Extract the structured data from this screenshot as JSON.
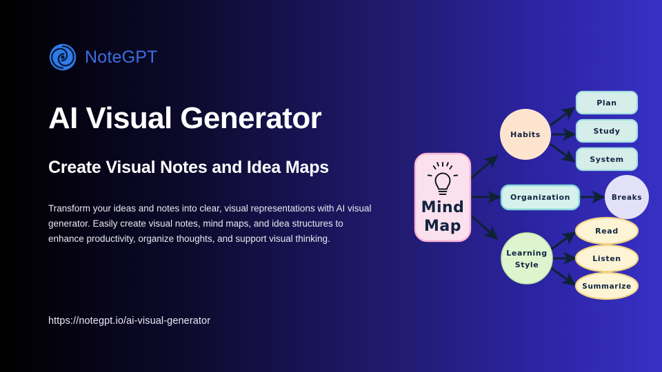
{
  "brand": {
    "name": "NoteGPT",
    "logo_icon": "spiral-swirl-icon",
    "color": "#3b6fe0"
  },
  "hero": {
    "title": "AI Visual Generator",
    "subtitle": "Create Visual Notes and Idea Maps",
    "description": "Transform your ideas and notes into clear, visual representations with AI visual generator. Easily create visual notes, mind maps, and idea structures to enhance productivity, organize thoughts, and support visual thinking.",
    "url": "https://notegpt.io/ai-visual-generator"
  },
  "background": {
    "gradient_from": "#000000",
    "gradient_to": "#3730c4"
  },
  "diagram": {
    "type": "mind-map",
    "center": {
      "label_line1": "Mind",
      "label_line2": "Map",
      "icon": "lightbulb-icon",
      "fill": "#fbe0ee",
      "stroke": "#f5a8cf"
    },
    "branches": [
      {
        "label": "Habits",
        "shape": "circle",
        "fill": "#fde4cf",
        "children": [
          {
            "label": "Plan",
            "shape": "rounded-rect",
            "fill": "#d6eeea",
            "stroke": "#9bd8e0"
          },
          {
            "label": "Study",
            "shape": "rounded-rect",
            "fill": "#d6eeea",
            "stroke": "#9bd8e0"
          },
          {
            "label": "System",
            "shape": "rounded-rect",
            "fill": "#d6eeea",
            "stroke": "#9bd8e0"
          }
        ]
      },
      {
        "label": "Organization",
        "shape": "rounded-rect",
        "fill": "#d6f1ec",
        "stroke": "#7fd4d8",
        "children": [
          {
            "label": "Breaks",
            "shape": "circle",
            "fill": "#e3e1f7",
            "stroke": "#e3e1f7"
          }
        ]
      },
      {
        "label_line1": "Learning",
        "label_line2": "Style",
        "label": "Learning Style",
        "shape": "circle",
        "fill": "#ddf4cf",
        "stroke": "#b9e49d",
        "children": [
          {
            "label": "Read",
            "shape": "ellipse",
            "fill": "#fdf4d6",
            "stroke": "#f0d47a"
          },
          {
            "label": "Listen",
            "shape": "ellipse",
            "fill": "#fdf4d6",
            "stroke": "#f0d47a"
          },
          {
            "label": "Summarize",
            "shape": "ellipse",
            "fill": "#fdf4d6",
            "stroke": "#f0d47a"
          }
        ]
      }
    ],
    "arrow_color": "#0e2236"
  }
}
